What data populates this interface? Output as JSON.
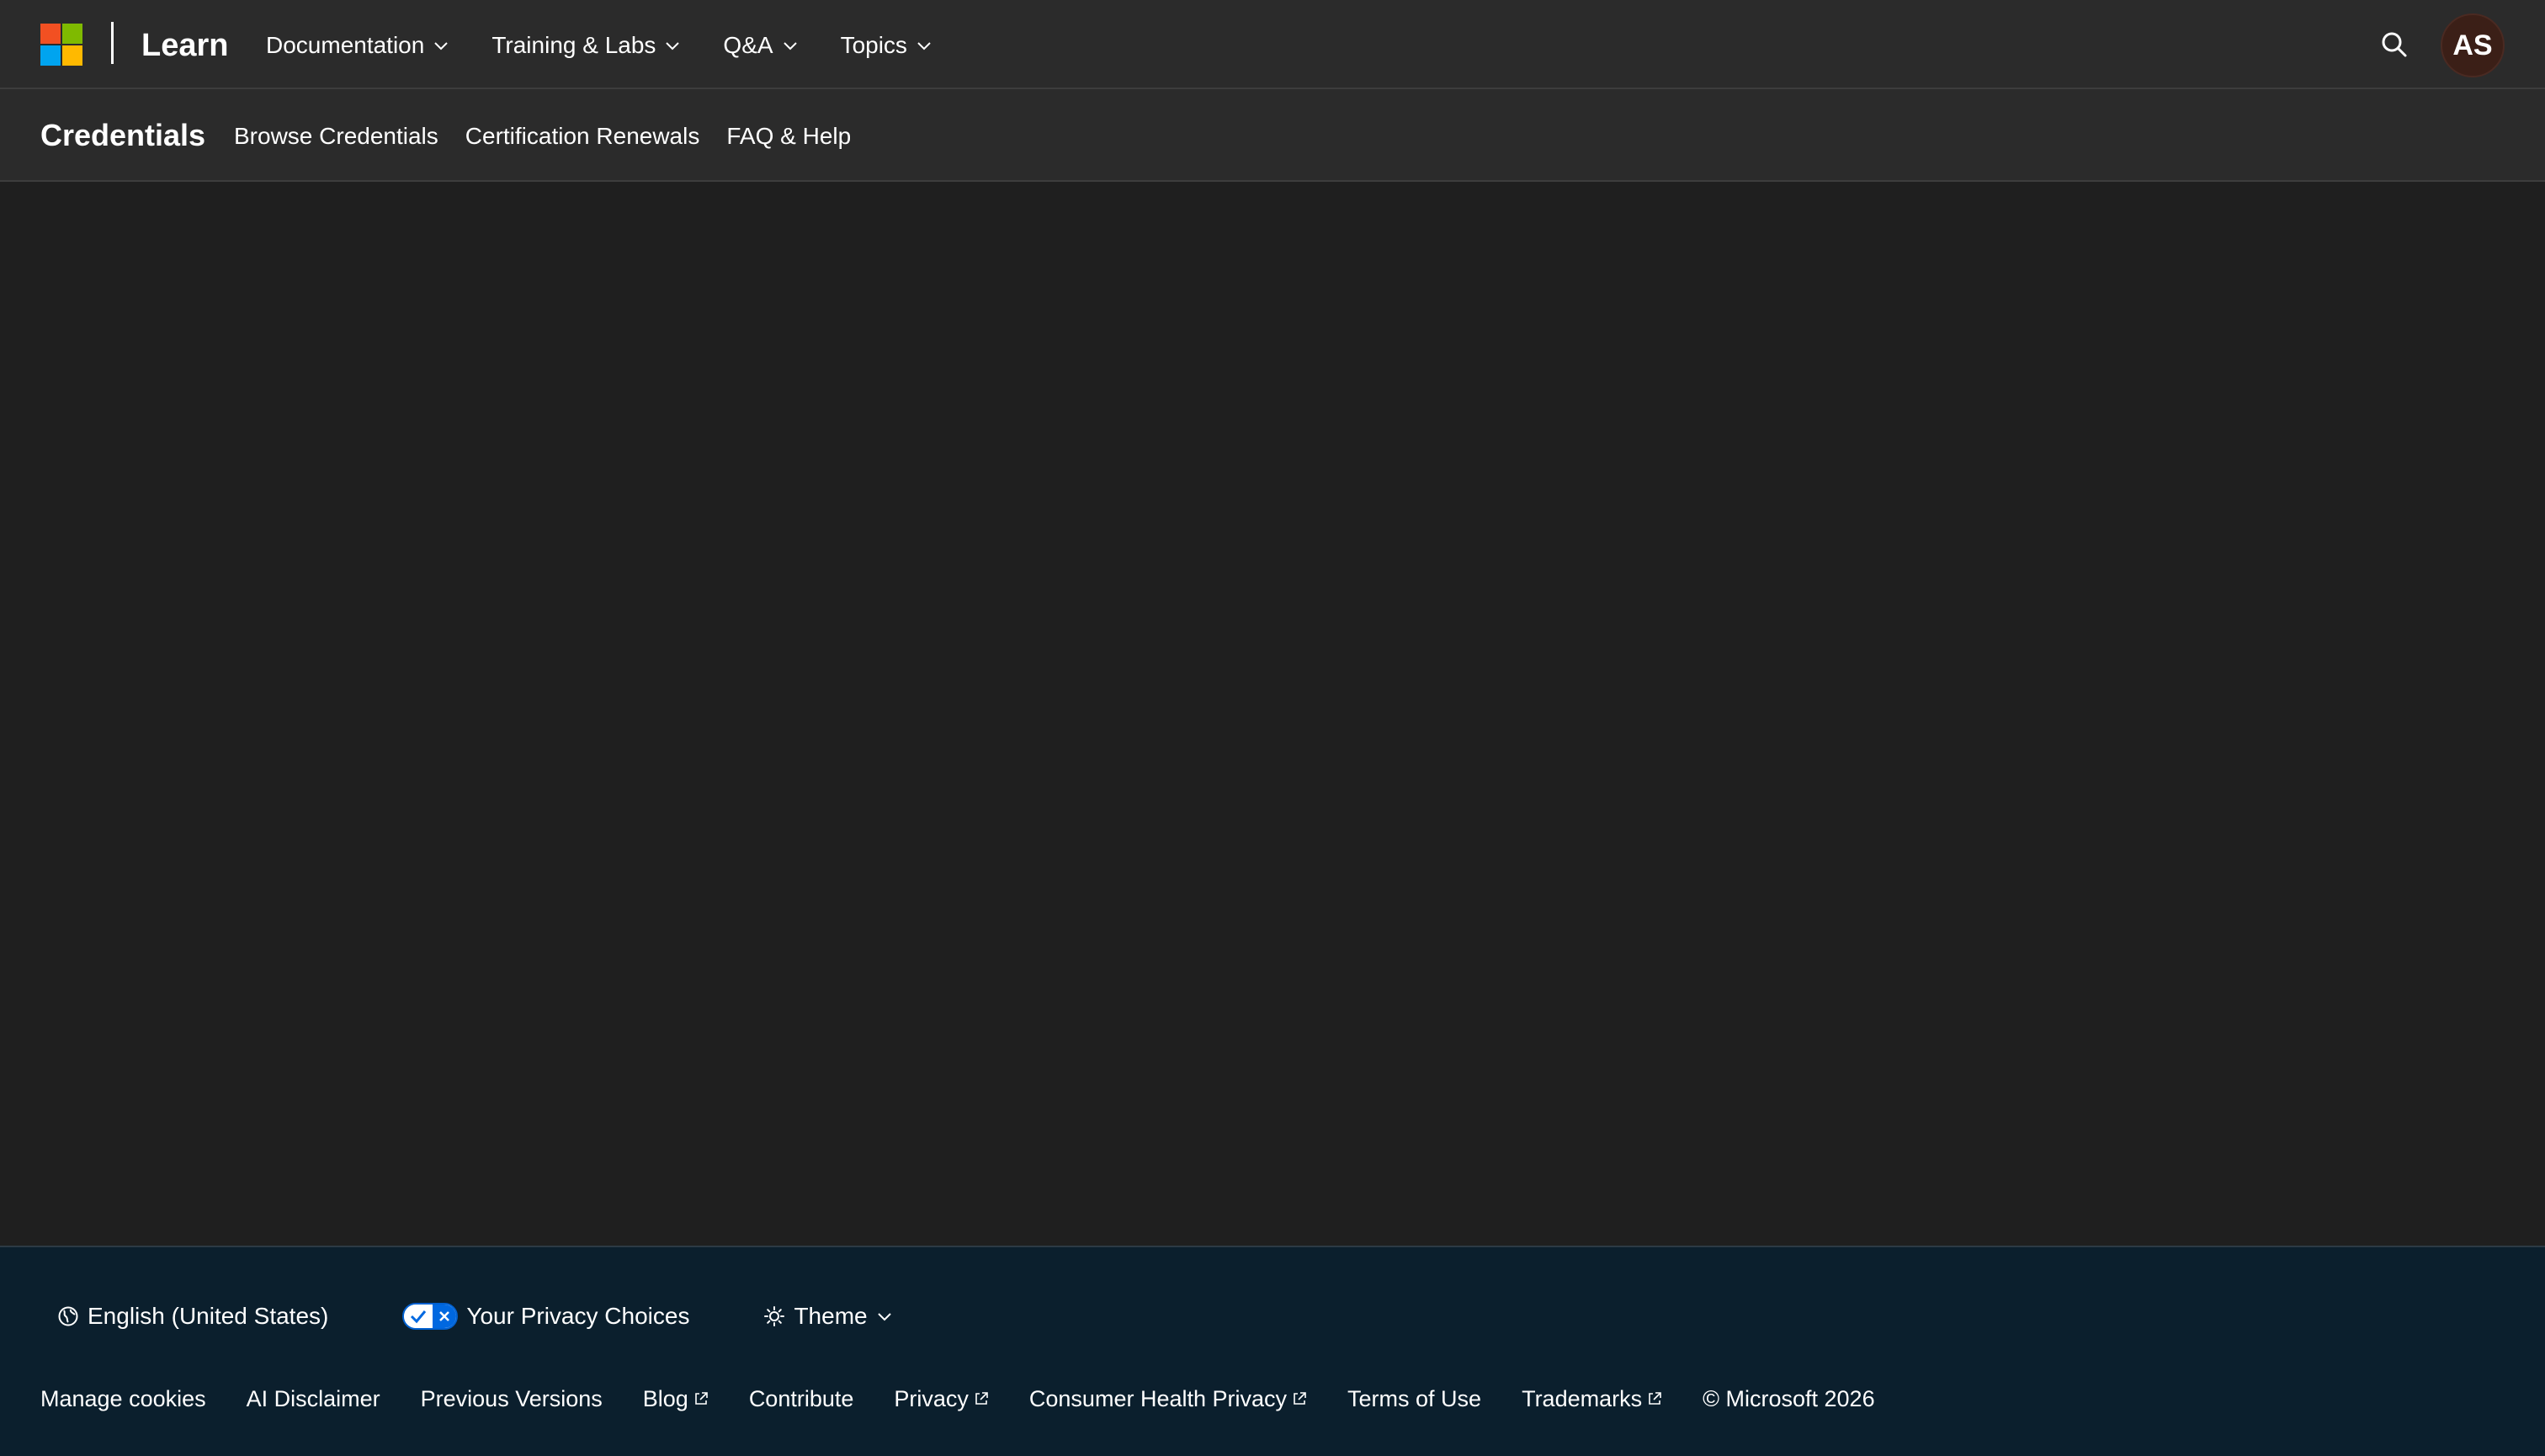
{
  "header": {
    "brand": "Learn",
    "nav": [
      {
        "label": "Documentation"
      },
      {
        "label": "Training & Labs"
      },
      {
        "label": "Q&A"
      },
      {
        "label": "Topics"
      }
    ],
    "avatar_initials": "AS"
  },
  "subheader": {
    "title": "Credentials",
    "links": [
      {
        "label": "Browse Credentials"
      },
      {
        "label": "Certification Renewals"
      },
      {
        "label": "FAQ & Help"
      }
    ]
  },
  "footer": {
    "language": "English (United States)",
    "privacy_choices": "Your Privacy Choices",
    "theme": "Theme",
    "links": [
      {
        "label": "Manage cookies"
      },
      {
        "label": "AI Disclaimer"
      },
      {
        "label": "Previous Versions"
      },
      {
        "label": "Blog"
      },
      {
        "label": "Contribute"
      },
      {
        "label": "Privacy"
      },
      {
        "label": "Consumer Health Privacy"
      },
      {
        "label": "Terms of Use"
      },
      {
        "label": "Trademarks"
      }
    ],
    "copyright": "© Microsoft 2026"
  },
  "colors": {
    "header_bg": "#2b2b2b",
    "page_bg": "#1f1f1f",
    "footer_bg": "#0b1f2d",
    "ms_red": "#f25022",
    "ms_green": "#7fba00",
    "ms_blue": "#00a4ef",
    "ms_yellow": "#ffb900",
    "avatar_bg": "#3b1f17",
    "toggle_blue": "#0068e0"
  },
  "icons": {
    "logo": "microsoft-logo-icon",
    "search": "search-icon",
    "chevron": "chevron-down-icon",
    "globe": "globe-icon",
    "privacy": "privacy-toggle-icon",
    "theme": "sun-icon",
    "external": "external-link-icon"
  }
}
